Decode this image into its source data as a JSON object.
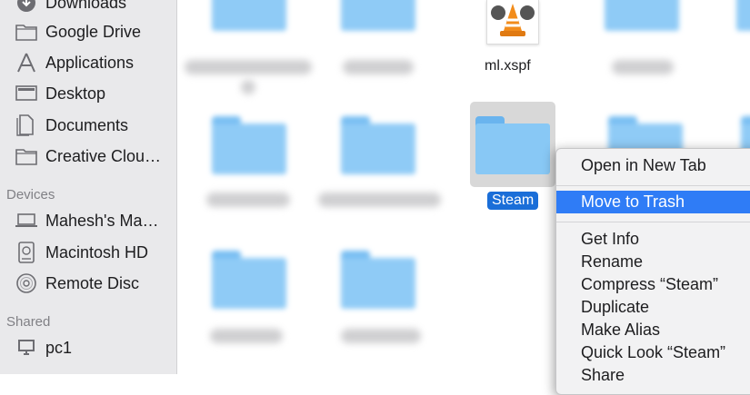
{
  "sidebar": {
    "items": [
      {
        "label": "Downloads",
        "icon": "downloads-icon"
      },
      {
        "label": "Google Drive",
        "icon": "folder-icon"
      },
      {
        "label": "Applications",
        "icon": "applications-icon"
      },
      {
        "label": "Desktop",
        "icon": "desktop-icon"
      },
      {
        "label": "Documents",
        "icon": "documents-icon"
      },
      {
        "label": "Creative Clou…",
        "icon": "folder-icon"
      }
    ],
    "devices_header": "Devices",
    "devices": [
      {
        "label": "Mahesh's Ma…",
        "icon": "laptop-icon"
      },
      {
        "label": "Macintosh HD",
        "icon": "hard-drive-icon"
      },
      {
        "label": "Remote Disc",
        "icon": "disc-icon"
      }
    ],
    "shared_header": "Shared",
    "shared": [
      {
        "label": "pc1",
        "icon": "computer-icon"
      }
    ]
  },
  "content": {
    "file_label": "ml.xspf",
    "selected_label": "Steam"
  },
  "context_menu": {
    "items": [
      {
        "label": "Open in New Tab"
      },
      {
        "label": "Move to Trash",
        "selected": true
      },
      {
        "label": "Get Info"
      },
      {
        "label": "Rename"
      },
      {
        "label": "Compress “Steam”"
      },
      {
        "label": "Duplicate"
      },
      {
        "label": "Make Alias"
      },
      {
        "label": "Quick Look “Steam”"
      },
      {
        "label": "Share"
      }
    ]
  },
  "colors": {
    "selection": "#2f7cf6",
    "folder": "#8fcbf6",
    "sidebar_bg": "#e9e9eb"
  }
}
